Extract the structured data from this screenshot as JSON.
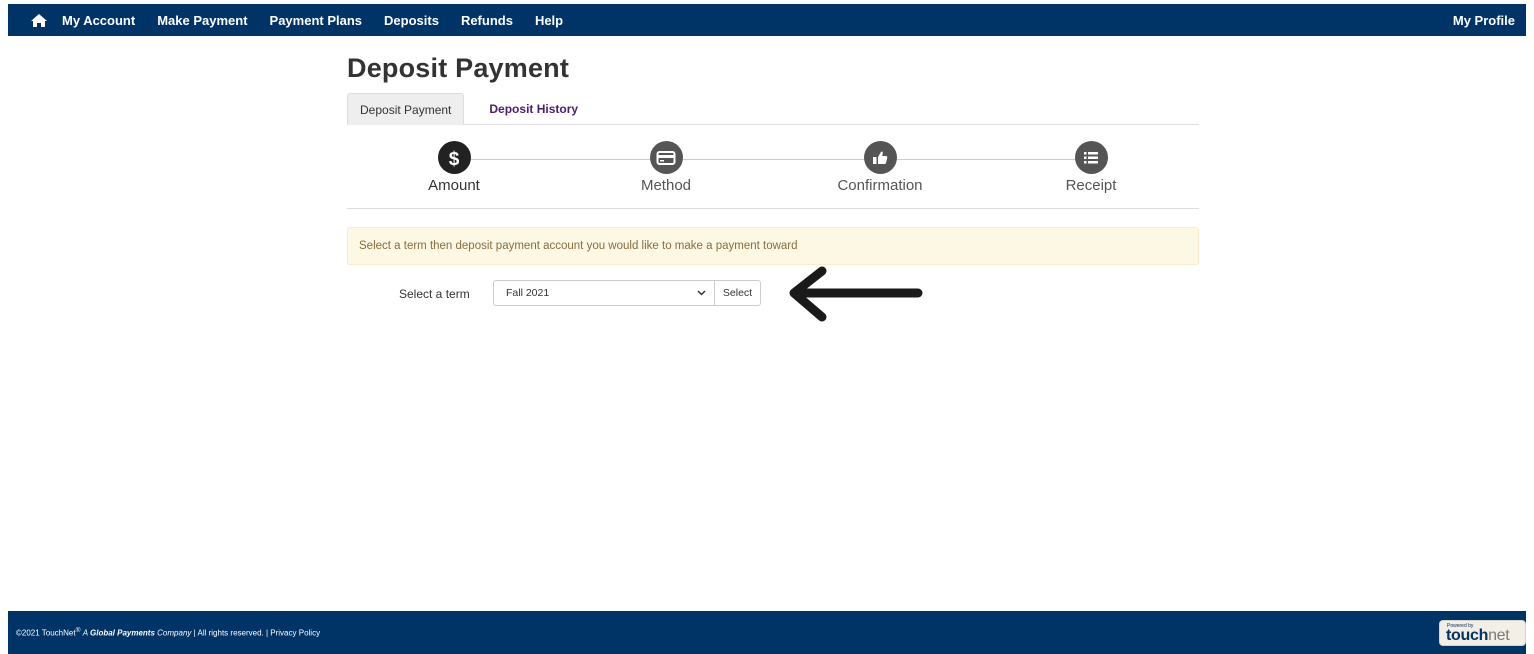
{
  "nav": {
    "items": [
      "My Account",
      "Make Payment",
      "Payment Plans",
      "Deposits",
      "Refunds",
      "Help"
    ],
    "profile": "My Profile"
  },
  "page": {
    "title": "Deposit Payment",
    "tabs": [
      {
        "label": "Deposit Payment",
        "active": true
      },
      {
        "label": "Deposit History",
        "active": false
      }
    ]
  },
  "steps": [
    {
      "label": "Amount",
      "icon": "dollar-icon",
      "current": true
    },
    {
      "label": "Method",
      "icon": "credit-card-icon",
      "current": false
    },
    {
      "label": "Confirmation",
      "icon": "thumbs-up-icon",
      "current": false
    },
    {
      "label": "Receipt",
      "icon": "list-icon",
      "current": false
    }
  ],
  "alert": {
    "text": "Select a term then deposit payment account you would like to make a payment toward"
  },
  "term": {
    "label": "Select a term",
    "selected": "Fall 2021",
    "button": "Select"
  },
  "footer": {
    "copyright": "©2021 TouchNet",
    "company_prefix": "A",
    "company_bold": "Global Payments",
    "company_suffix": "Company",
    "rights": "| All rights reserved. |",
    "privacy": "Privacy Policy",
    "logo_powered": "Powered by",
    "logo_bold": "touch",
    "logo_light": "net"
  },
  "colors": {
    "nav_bg": "#003366",
    "alert_bg": "#fcf8e3",
    "alert_text": "#8a6d3b",
    "tab_link": "#4b2070"
  }
}
